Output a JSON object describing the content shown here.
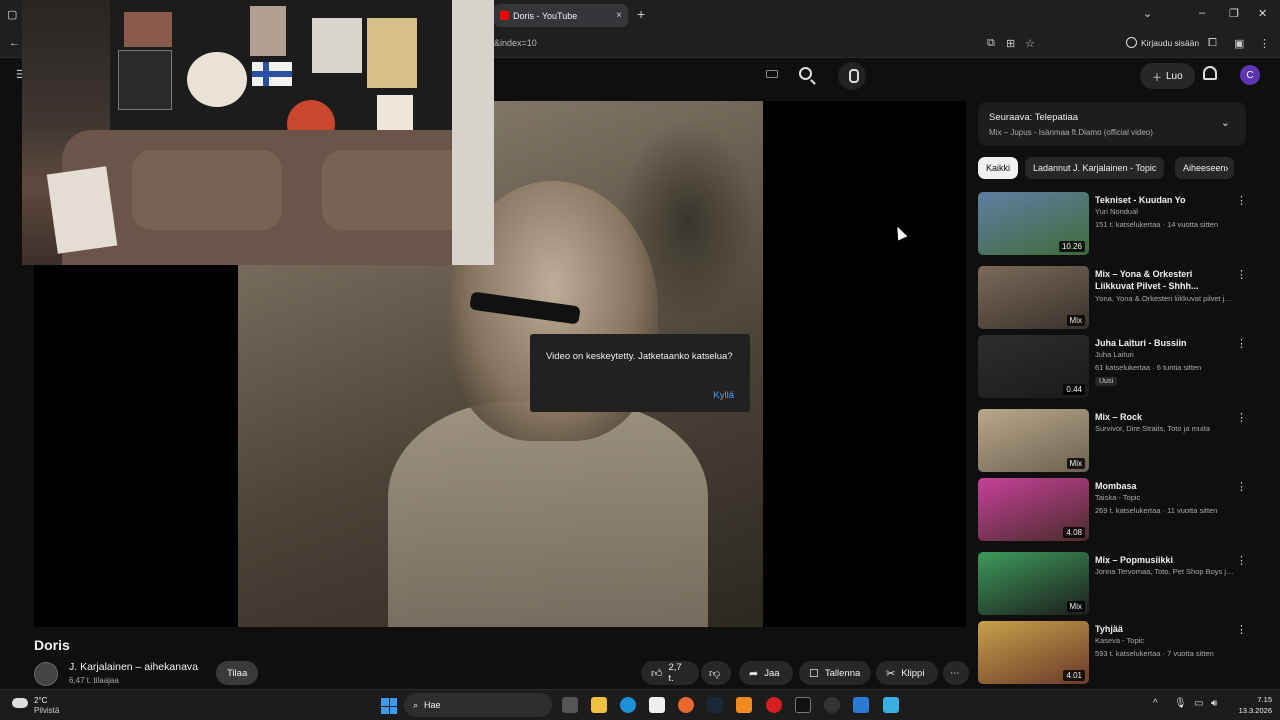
{
  "browser": {
    "tab_title": "Doris - YouTube",
    "tab_close": "×",
    "new_tab": "+",
    "url_tail": "&index=10",
    "signin": "Kirjaudu sisään"
  },
  "header": {
    "create": "Luo",
    "avatar_letter": "C"
  },
  "pause_dialog": {
    "text": "Video on keskeytetty. Jatketaanko katselua?",
    "yes": "Kyllä"
  },
  "video": {
    "title": "Doris",
    "channel": "J. Karjalainen – aihekanava",
    "subs": "6,47 t. tilaajaa",
    "subscribe": "Tilaa",
    "likes": "2,7 t.",
    "share": "Jaa",
    "save": "Tallenna",
    "clip": "Klippi",
    "more": "⋯"
  },
  "sidebar": {
    "upnext_title": "Seuraava: Telepatiaa",
    "upnext_sub": "Mix – Jupus - Isänmaa ft.Diamo (official video)",
    "chips": [
      "Kaikki",
      "Ladannut J. Karjalainen - Topic",
      "Aiheeseen"
    ],
    "recs": [
      {
        "title": "Tekniset - Kuudan Yo",
        "channel": "Yuri Nondual",
        "meta": "151 t. katselukertaa · 14 vuotta sitten",
        "badge": "10.26",
        "colors": [
          "#5e7fa3",
          "#3f6b3a"
        ]
      },
      {
        "title": "Mix – Yona & Orkesteri Liikkuvat Pilvet - Shhh...",
        "channel": "Yona, Yona & Orkesteri liikkuvat pilvet ja ...",
        "meta": "",
        "badge": "Mix",
        "colors": [
          "#7a6a5a",
          "#3a322b"
        ]
      },
      {
        "title": "Juha Laituri - Bussiin",
        "channel": "Juha Laituri",
        "meta": "61 katselukertaa · 6 tuntia sitten",
        "badge": "0.44",
        "new": "Uusi",
        "colors": [
          "#2e2e2e",
          "#1a1a1a"
        ]
      },
      {
        "title": "Mix – Rock",
        "channel": "Survivor, Dire Straits, Toto ja muita",
        "meta": "",
        "badge": "Mix",
        "colors": [
          "#b8a88a",
          "#6e6250"
        ]
      },
      {
        "title": "Mombasa",
        "channel": "Taiska - Topic",
        "meta": "269 t. katselukertaa · 11 vuotta sitten",
        "badge": "4.08",
        "colors": [
          "#c7409a",
          "#4a2c2a"
        ]
      },
      {
        "title": "Mix – Popmusiikki",
        "channel": "Jonna Tervomaa, Toto, Pet Shop Boys ja ...",
        "meta": "",
        "badge": "Mix",
        "colors": [
          "#3d9a5a",
          "#1d1d1d"
        ]
      },
      {
        "title": "Tyhjää",
        "channel": "Kaseva - Topic",
        "meta": "593 t. katselukertaa · 7 vuotta sitten",
        "badge": "4.01",
        "colors": [
          "#c9a04a",
          "#6a3a2a"
        ]
      }
    ]
  },
  "taskbar": {
    "temp": "2°C",
    "condition": "Pilvistä",
    "search": "Hae",
    "time": "7.15",
    "date": "13.3.2026"
  }
}
